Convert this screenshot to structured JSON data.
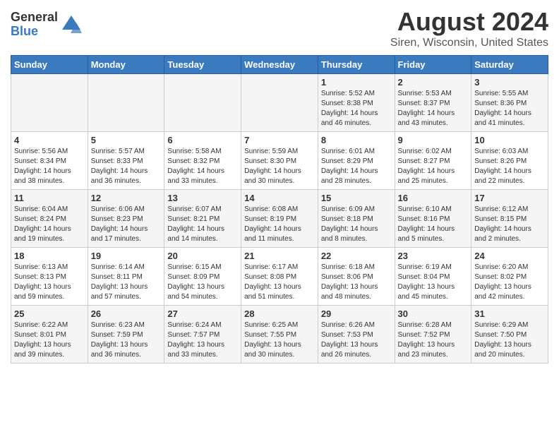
{
  "header": {
    "logo_general": "General",
    "logo_blue": "Blue",
    "month_title": "August 2024",
    "location": "Siren, Wisconsin, United States"
  },
  "weekdays": [
    "Sunday",
    "Monday",
    "Tuesday",
    "Wednesday",
    "Thursday",
    "Friday",
    "Saturday"
  ],
  "weeks": [
    [
      {
        "day": "",
        "info": ""
      },
      {
        "day": "",
        "info": ""
      },
      {
        "day": "",
        "info": ""
      },
      {
        "day": "",
        "info": ""
      },
      {
        "day": "1",
        "info": "Sunrise: 5:52 AM\nSunset: 8:38 PM\nDaylight: 14 hours\nand 46 minutes."
      },
      {
        "day": "2",
        "info": "Sunrise: 5:53 AM\nSunset: 8:37 PM\nDaylight: 14 hours\nand 43 minutes."
      },
      {
        "day": "3",
        "info": "Sunrise: 5:55 AM\nSunset: 8:36 PM\nDaylight: 14 hours\nand 41 minutes."
      }
    ],
    [
      {
        "day": "4",
        "info": "Sunrise: 5:56 AM\nSunset: 8:34 PM\nDaylight: 14 hours\nand 38 minutes."
      },
      {
        "day": "5",
        "info": "Sunrise: 5:57 AM\nSunset: 8:33 PM\nDaylight: 14 hours\nand 36 minutes."
      },
      {
        "day": "6",
        "info": "Sunrise: 5:58 AM\nSunset: 8:32 PM\nDaylight: 14 hours\nand 33 minutes."
      },
      {
        "day": "7",
        "info": "Sunrise: 5:59 AM\nSunset: 8:30 PM\nDaylight: 14 hours\nand 30 minutes."
      },
      {
        "day": "8",
        "info": "Sunrise: 6:01 AM\nSunset: 8:29 PM\nDaylight: 14 hours\nand 28 minutes."
      },
      {
        "day": "9",
        "info": "Sunrise: 6:02 AM\nSunset: 8:27 PM\nDaylight: 14 hours\nand 25 minutes."
      },
      {
        "day": "10",
        "info": "Sunrise: 6:03 AM\nSunset: 8:26 PM\nDaylight: 14 hours\nand 22 minutes."
      }
    ],
    [
      {
        "day": "11",
        "info": "Sunrise: 6:04 AM\nSunset: 8:24 PM\nDaylight: 14 hours\nand 19 minutes."
      },
      {
        "day": "12",
        "info": "Sunrise: 6:06 AM\nSunset: 8:23 PM\nDaylight: 14 hours\nand 17 minutes."
      },
      {
        "day": "13",
        "info": "Sunrise: 6:07 AM\nSunset: 8:21 PM\nDaylight: 14 hours\nand 14 minutes."
      },
      {
        "day": "14",
        "info": "Sunrise: 6:08 AM\nSunset: 8:19 PM\nDaylight: 14 hours\nand 11 minutes."
      },
      {
        "day": "15",
        "info": "Sunrise: 6:09 AM\nSunset: 8:18 PM\nDaylight: 14 hours\nand 8 minutes."
      },
      {
        "day": "16",
        "info": "Sunrise: 6:10 AM\nSunset: 8:16 PM\nDaylight: 14 hours\nand 5 minutes."
      },
      {
        "day": "17",
        "info": "Sunrise: 6:12 AM\nSunset: 8:15 PM\nDaylight: 14 hours\nand 2 minutes."
      }
    ],
    [
      {
        "day": "18",
        "info": "Sunrise: 6:13 AM\nSunset: 8:13 PM\nDaylight: 13 hours\nand 59 minutes."
      },
      {
        "day": "19",
        "info": "Sunrise: 6:14 AM\nSunset: 8:11 PM\nDaylight: 13 hours\nand 57 minutes."
      },
      {
        "day": "20",
        "info": "Sunrise: 6:15 AM\nSunset: 8:09 PM\nDaylight: 13 hours\nand 54 minutes."
      },
      {
        "day": "21",
        "info": "Sunrise: 6:17 AM\nSunset: 8:08 PM\nDaylight: 13 hours\nand 51 minutes."
      },
      {
        "day": "22",
        "info": "Sunrise: 6:18 AM\nSunset: 8:06 PM\nDaylight: 13 hours\nand 48 minutes."
      },
      {
        "day": "23",
        "info": "Sunrise: 6:19 AM\nSunset: 8:04 PM\nDaylight: 13 hours\nand 45 minutes."
      },
      {
        "day": "24",
        "info": "Sunrise: 6:20 AM\nSunset: 8:02 PM\nDaylight: 13 hours\nand 42 minutes."
      }
    ],
    [
      {
        "day": "25",
        "info": "Sunrise: 6:22 AM\nSunset: 8:01 PM\nDaylight: 13 hours\nand 39 minutes."
      },
      {
        "day": "26",
        "info": "Sunrise: 6:23 AM\nSunset: 7:59 PM\nDaylight: 13 hours\nand 36 minutes."
      },
      {
        "day": "27",
        "info": "Sunrise: 6:24 AM\nSunset: 7:57 PM\nDaylight: 13 hours\nand 33 minutes."
      },
      {
        "day": "28",
        "info": "Sunrise: 6:25 AM\nSunset: 7:55 PM\nDaylight: 13 hours\nand 30 minutes."
      },
      {
        "day": "29",
        "info": "Sunrise: 6:26 AM\nSunset: 7:53 PM\nDaylight: 13 hours\nand 26 minutes."
      },
      {
        "day": "30",
        "info": "Sunrise: 6:28 AM\nSunset: 7:52 PM\nDaylight: 13 hours\nand 23 minutes."
      },
      {
        "day": "31",
        "info": "Sunrise: 6:29 AM\nSunset: 7:50 PM\nDaylight: 13 hours\nand 20 minutes."
      }
    ]
  ]
}
